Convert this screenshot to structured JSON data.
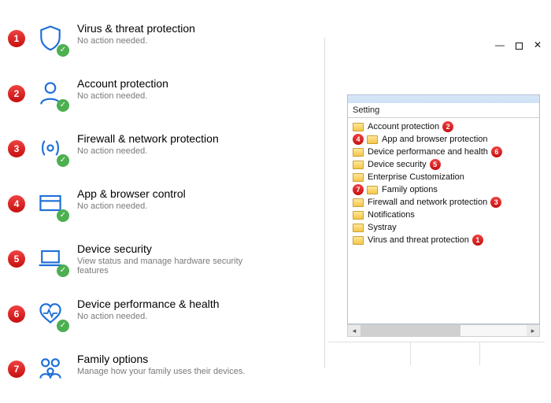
{
  "security_items": [
    {
      "num": "1",
      "title": "Virus & threat protection",
      "sub": "No action needed.",
      "check": true
    },
    {
      "num": "2",
      "title": "Account protection",
      "sub": "No action needed.",
      "check": true
    },
    {
      "num": "3",
      "title": "Firewall & network protection",
      "sub": "No action needed.",
      "check": true
    },
    {
      "num": "4",
      "title": "App & browser control",
      "sub": "No action needed.",
      "check": true
    },
    {
      "num": "5",
      "title": "Device security",
      "sub": "View status and manage hardware security features",
      "check": true
    },
    {
      "num": "6",
      "title": "Device performance & health",
      "sub": "No action needed.",
      "check": true
    },
    {
      "num": "7",
      "title": "Family options",
      "sub": "Manage how your family uses their devices.",
      "check": false
    }
  ],
  "policy": {
    "header": "Setting",
    "rows": [
      {
        "lead": null,
        "label": "Account protection",
        "trail": "2"
      },
      {
        "lead": "4",
        "label": "App and browser protection",
        "trail": null
      },
      {
        "lead": null,
        "label": "Device performance and health",
        "trail": "6"
      },
      {
        "lead": null,
        "label": "Device security",
        "trail": "5"
      },
      {
        "lead": null,
        "label": "Enterprise Customization",
        "trail": null
      },
      {
        "lead": "7",
        "label": "Family options",
        "trail": null
      },
      {
        "lead": null,
        "label": "Firewall and network protection",
        "trail": "3"
      },
      {
        "lead": null,
        "label": "Notifications",
        "trail": null
      },
      {
        "lead": null,
        "label": "Systray",
        "trail": null
      },
      {
        "lead": null,
        "label": "Virus and threat protection",
        "trail": "1"
      }
    ]
  },
  "window": {
    "minimize": "—",
    "close": "✕"
  }
}
